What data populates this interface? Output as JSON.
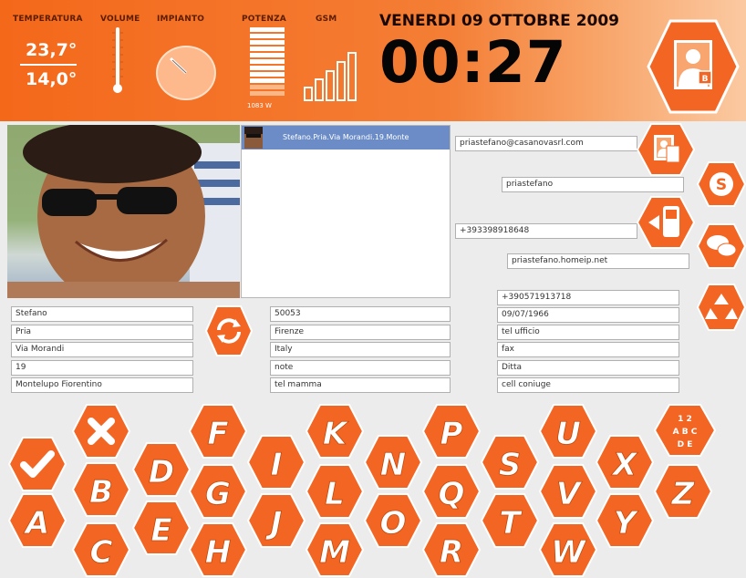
{
  "header": {
    "labels": {
      "temperatura": "TEMPERATURA",
      "volume": "VOLUME",
      "impianto": "IMPIANTO",
      "potenza": "POTENZA",
      "gsm": "GSM"
    },
    "temp_inside": "23,7°",
    "temp_outside": "14,0°",
    "power_watts": "1083 W",
    "date": "VENERDI 09 OTTOBRE 2009",
    "time": "00:27",
    "profile_badge": "B",
    "signal_bars": 5
  },
  "contact": {
    "list_entry": "Stefano.Pria.Via Morandi.19.Monte",
    "email": "priastefano@casanovasrl.com",
    "skype": "priastefano",
    "mobile": "+393398918648",
    "homepage": "priastefano.homeip.net",
    "left_fields": [
      "Stefano",
      "Pria",
      "Via Morandi",
      "19",
      "Montelupo Fiorentino"
    ],
    "mid_fields": [
      "50053",
      "Firenze",
      "Italy",
      "note",
      "tel mamma"
    ],
    "right_fields": [
      "+390571913718",
      "09/07/1966",
      "tel ufficio",
      "fax",
      "Ditta",
      "cell coniuge"
    ]
  },
  "keyboard": {
    "mode_labels": [
      "1 2",
      "A B C",
      "D E"
    ]
  },
  "colors": {
    "accent": "#f26522",
    "accent_border": "#ffffff",
    "header_label": "#5a1d00"
  }
}
